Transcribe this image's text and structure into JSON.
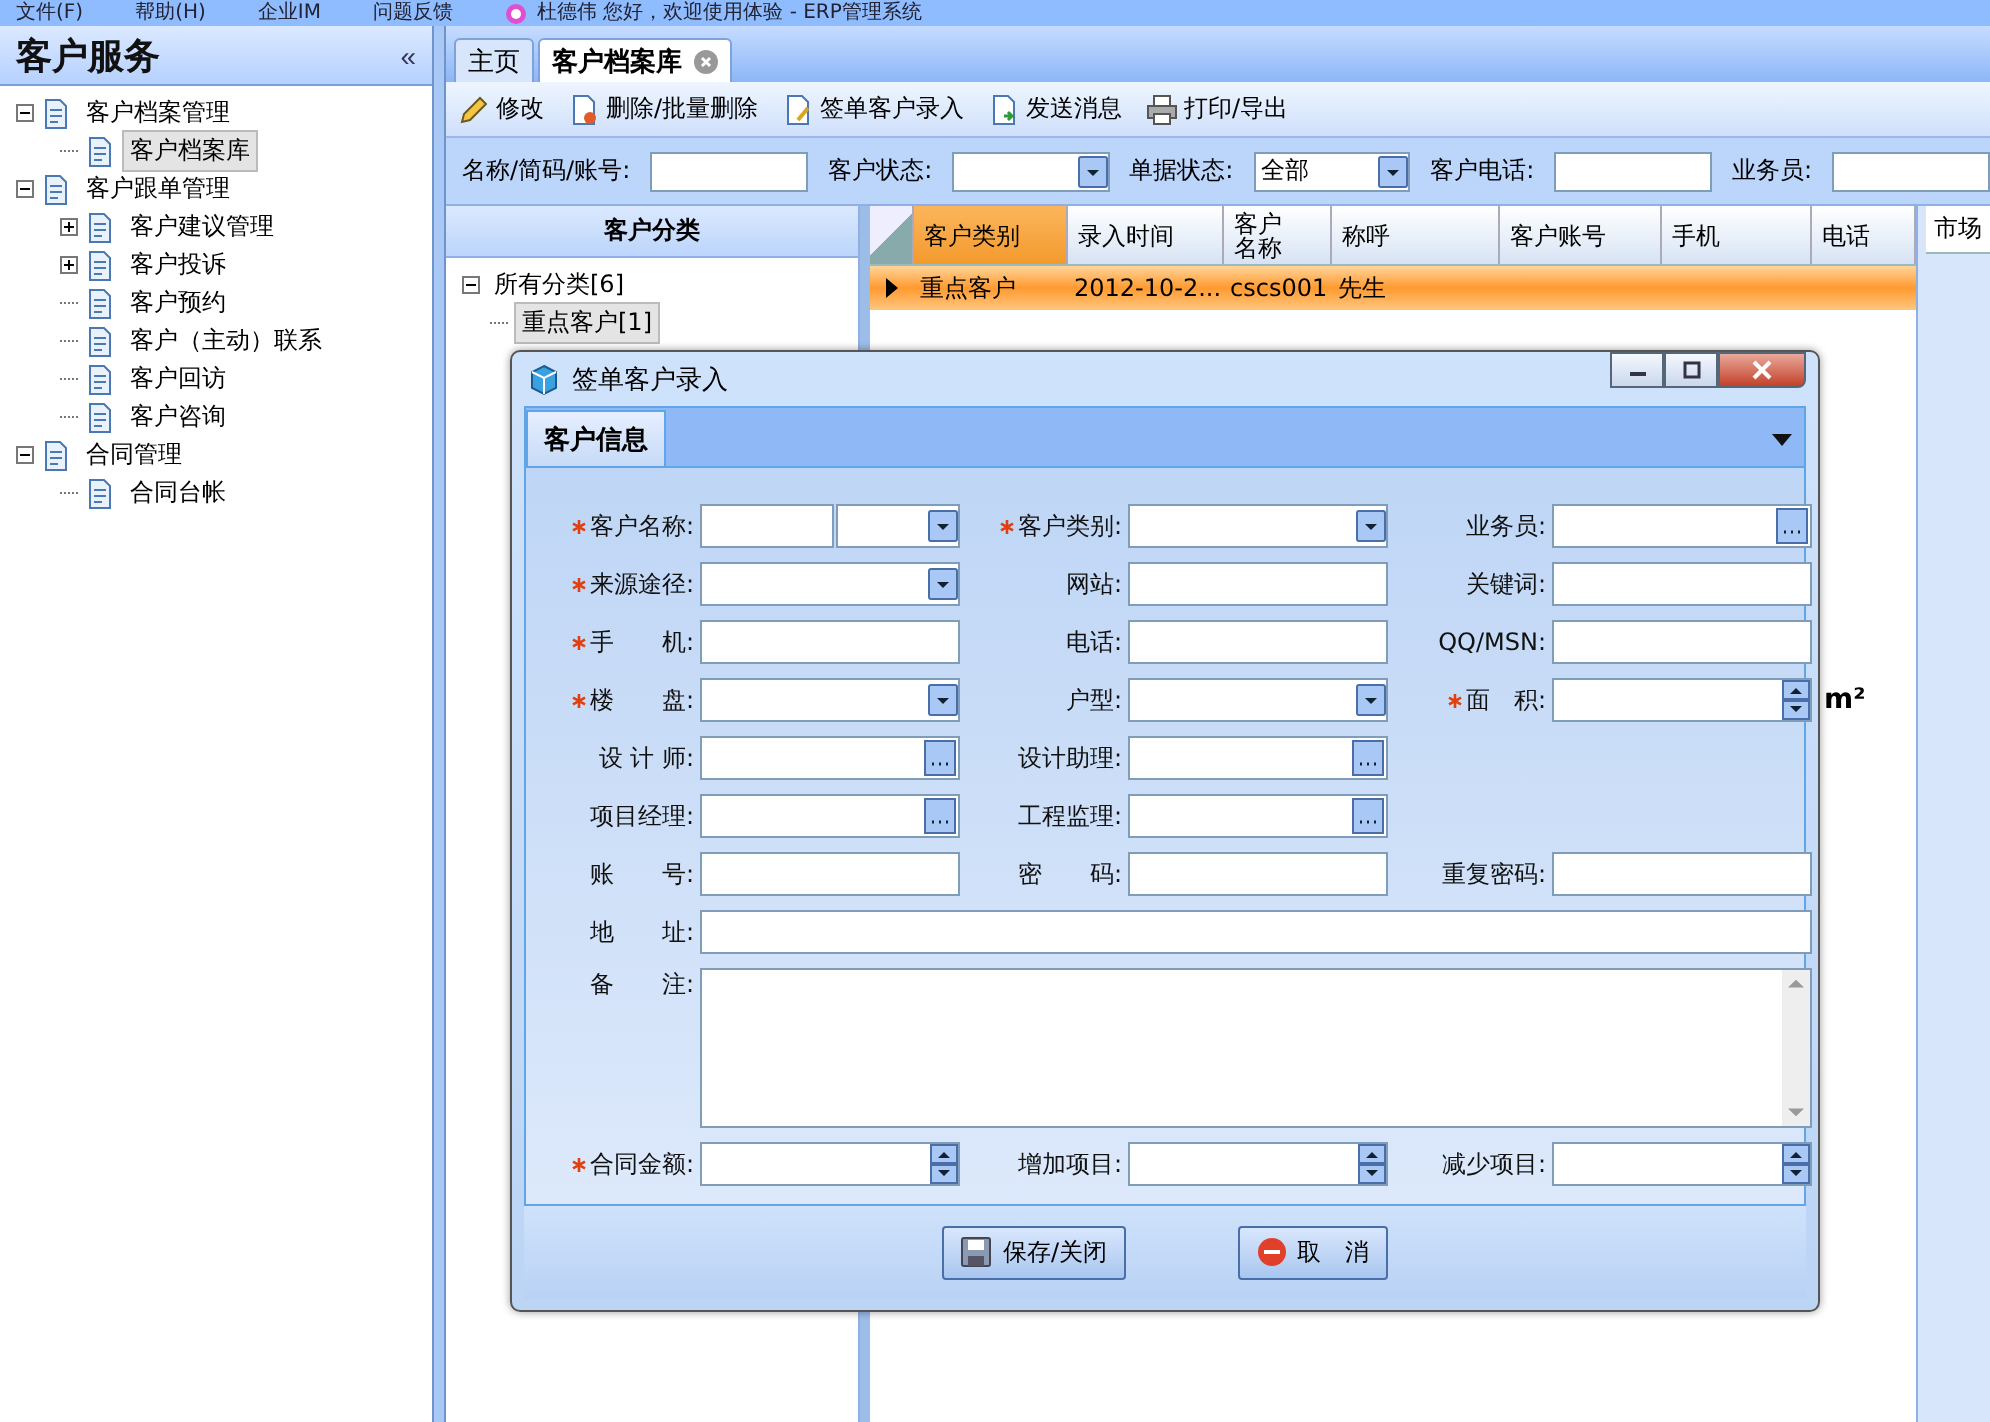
{
  "menu_bar": {
    "items": [
      "文件(F)",
      "帮助(H)",
      "企业IM",
      "问题反馈"
    ],
    "greeting": "杜德伟 您好，欢迎使用体验 - ERP管理系统"
  },
  "sidebar": {
    "title": "客户服务",
    "collapse": "«",
    "items": [
      {
        "label": "客户档案管理",
        "expanded": true,
        "selected": false,
        "children": [
          {
            "label": "客户档案库",
            "selected": true
          }
        ]
      },
      {
        "label": "客户跟单管理",
        "expanded": true,
        "selected": false,
        "children": [
          {
            "label": "客户建议管理",
            "expanded": false,
            "selected": false
          },
          {
            "label": "客户投诉",
            "expanded": false,
            "selected": false
          },
          {
            "label": "客户预约",
            "selected": false
          },
          {
            "label": "客户（主动）联系",
            "selected": false
          },
          {
            "label": "客户回访",
            "selected": false
          },
          {
            "label": "客户咨询",
            "selected": false
          }
        ]
      },
      {
        "label": "合同管理",
        "expanded": true,
        "selected": false,
        "children": [
          {
            "label": "合同台帐",
            "selected": false
          }
        ]
      }
    ]
  },
  "tabs": [
    {
      "label": "主页",
      "selected": false,
      "closable": false
    },
    {
      "label": "客户档案库",
      "selected": true,
      "closable": true
    }
  ],
  "toolbar": [
    "修改",
    "删除/批量删除",
    "签单客户录入",
    "发送消息",
    "打印/导出"
  ],
  "filters": [
    {
      "label": "名称/简码/账号:",
      "kind": "text"
    },
    {
      "label": "客户状态:",
      "kind": "combo"
    },
    {
      "label": "单据状态:",
      "kind": "combo",
      "value": "全部"
    },
    {
      "label": "客户电话:",
      "kind": "text"
    },
    {
      "label": "业务员:",
      "kind": "text"
    }
  ],
  "category_panel": {
    "title": "客户分类",
    "root": {
      "label": "所有分类[6]",
      "expanded": true,
      "children": [
        {
          "label": "重点客户[1]",
          "selected": true
        }
      ]
    }
  },
  "table": {
    "columns": [
      {
        "label": "客户类别",
        "highlighted": true
      },
      {
        "label": "录入时间",
        "highlighted": false
      },
      {
        "label": "客户名称",
        "highlighted": false
      },
      {
        "label": "称呼",
        "highlighted": false
      },
      {
        "label": "客户账号",
        "highlighted": false
      },
      {
        "label": "手机",
        "highlighted": false
      },
      {
        "label": "电话",
        "highlighted": false
      }
    ],
    "rows": [
      {
        "selected": true,
        "cells": [
          "重点客户",
          "2012-10-2...",
          "cscs001",
          "先生",
          "",
          "",
          ""
        ]
      }
    ]
  },
  "side_panel": {
    "title": "市场"
  },
  "dialog": {
    "title": "签单客户录入",
    "tab": {
      "label": "客户信息",
      "selected": true
    },
    "rows": [
      [
        {
          "label": "客户名称:",
          "required": true,
          "kind": "split"
        },
        {
          "label": "客户类别:",
          "required": true,
          "kind": "combo"
        },
        {
          "label": "业务员:",
          "required": false,
          "kind": "picker"
        }
      ],
      [
        {
          "label": "来源途径:",
          "required": true,
          "kind": "combo"
        },
        {
          "label": "网站:",
          "required": false,
          "kind": "text"
        },
        {
          "label": "关键词:",
          "required": false,
          "kind": "text"
        }
      ],
      [
        {
          "label": "手　　机:",
          "required": true,
          "kind": "text"
        },
        {
          "label": "电话:",
          "required": false,
          "kind": "text"
        },
        {
          "label": "QQ/MSN:",
          "required": false,
          "kind": "text"
        }
      ],
      [
        {
          "label": "楼　　盘:",
          "required": true,
          "kind": "combo"
        },
        {
          "label": "户型:",
          "required": false,
          "kind": "combo"
        },
        {
          "label": "面　积:",
          "required": true,
          "kind": "spin",
          "unit": "m²"
        }
      ],
      [
        {
          "label": "设 计 师:",
          "required": false,
          "kind": "picker"
        },
        {
          "label": "设计助理:",
          "required": false,
          "kind": "picker"
        }
      ],
      [
        {
          "label": "项目经理:",
          "required": false,
          "kind": "picker"
        },
        {
          "label": "工程监理:",
          "required": false,
          "kind": "picker"
        }
      ],
      [
        {
          "label": "账　　号:",
          "required": false,
          "kind": "text"
        },
        {
          "label": "密　　码:",
          "required": false,
          "kind": "text"
        },
        {
          "label": "重复密码:",
          "required": false,
          "kind": "text"
        }
      ],
      [
        {
          "label": "地　　址:",
          "required": false,
          "kind": "wide"
        }
      ],
      [
        {
          "label": "备　　注:",
          "required": false,
          "kind": "memo"
        }
      ],
      [
        {
          "label": "合同金额:",
          "required": true,
          "kind": "spin"
        },
        {
          "label": "增加项目:",
          "required": false,
          "kind": "spin"
        },
        {
          "label": "减少项目:",
          "required": false,
          "kind": "spin"
        }
      ]
    ],
    "buttons": [
      {
        "label": "保存/关闭",
        "kind": "save"
      },
      {
        "label": "取　消",
        "kind": "cancel"
      }
    ]
  }
}
